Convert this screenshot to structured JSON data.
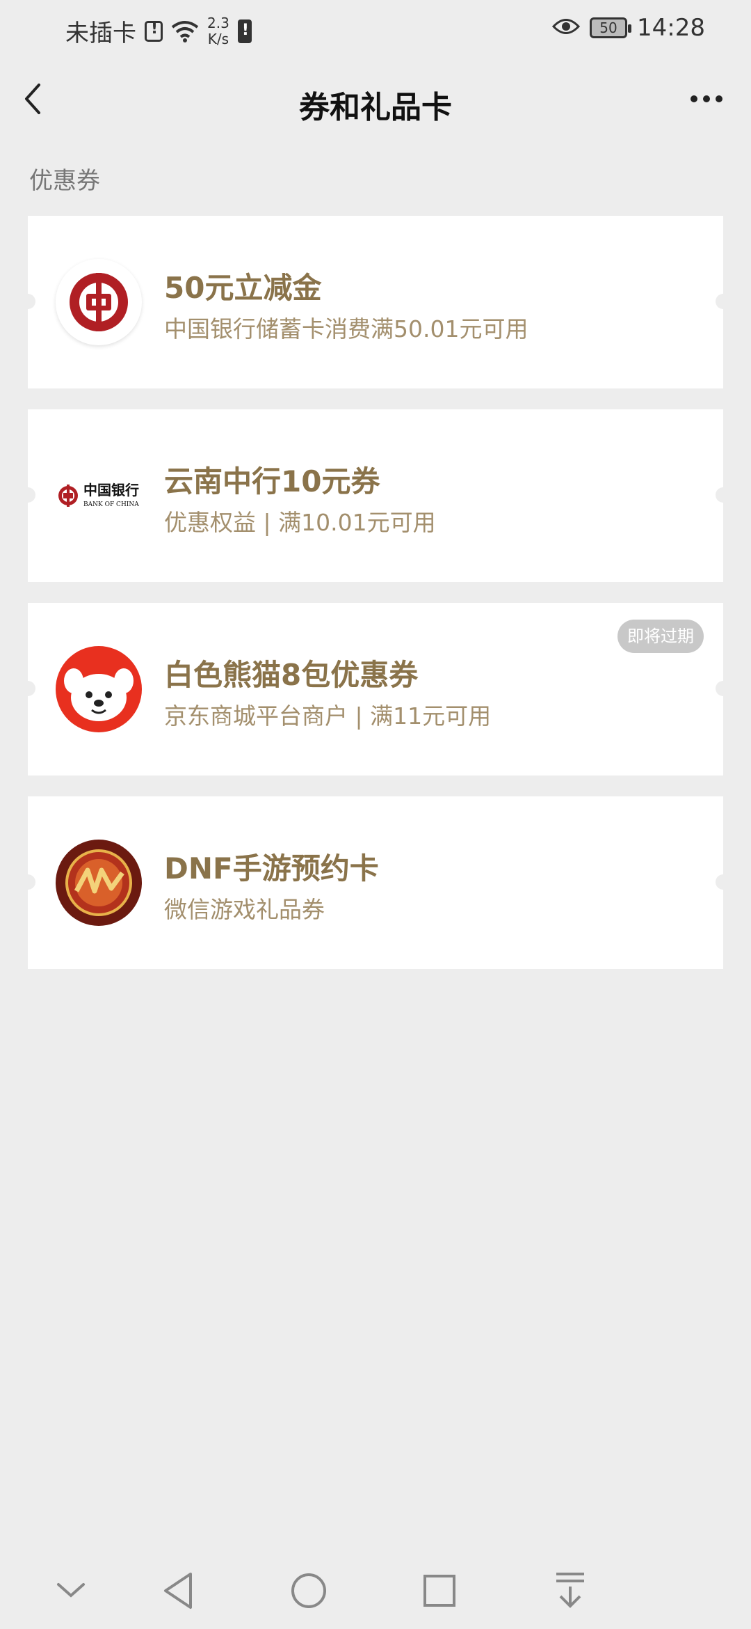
{
  "status_bar": {
    "carrier": "未插卡",
    "speed_value": "2.3",
    "speed_unit": "K/s",
    "battery": "50",
    "time": "14:28"
  },
  "header": {
    "title": "券和礼品卡"
  },
  "section": {
    "label": "优惠券"
  },
  "coupons": [
    {
      "title": "50元立减金",
      "desc": "中国银行储蓄卡消费满50.01元可用",
      "icon": "bank-of-china-logo-icon"
    },
    {
      "title": "云南中行10元券",
      "desc": "优惠权益 | 满10.01元可用",
      "icon": "bank-of-china-wordmark-icon",
      "logo_text_cn": "中国银行",
      "logo_text_en": "BANK OF CHINA"
    },
    {
      "title": "白色熊猫8包优惠券",
      "desc": "京东商城平台商户 | 满11元可用",
      "icon": "jd-joy-dog-icon",
      "badge": "即将过期"
    },
    {
      "title": "DNF手游预约卡",
      "desc": "微信游戏礼品券",
      "icon": "dnf-game-icon"
    }
  ],
  "nav_bar": {
    "icons": [
      "chevron-down-icon",
      "back-triangle-icon",
      "home-circle-icon",
      "recents-square-icon",
      "pull-down-icon"
    ]
  },
  "colors": {
    "background": "#ededed",
    "title_gold": "#8a734a",
    "desc_gold": "#a38f6d",
    "badge_bg": "#c8c8c8"
  }
}
